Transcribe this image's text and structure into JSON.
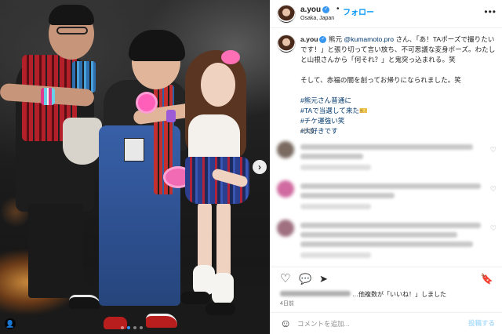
{
  "post": {
    "username": "a.you",
    "follow_label": "フォロー",
    "separator": "•",
    "location": "Osaka, Japan",
    "caption": {
      "author": "a.you",
      "line1_pre": "熊元 ",
      "mention": "@kumamoto.pro",
      "line1_post": " さん、「あ！TAポーズで撮りたいです！」と張り切って言い放ち、不可思議な変身ポーズ。わたしと山根さんから「何それ？」と鬼突っ込まれる。笑",
      "line2": "そして、赤福の闇を創ってお帰りになられました。笑",
      "hashtags": [
        "#熊元さん普通に",
        "#TAで当選して来た",
        "#チケ運強い笑",
        "#大好きです"
      ],
      "hashtag_emoji": "🎫",
      "time": "4日前"
    },
    "likes_suffix": "…他複数が「いいね！」しました",
    "time": "4日前",
    "comment_placeholder": "コメントを追加...",
    "post_label": "投稿する"
  },
  "icons": {
    "verified": "✓",
    "more": "•••",
    "next": "›",
    "user_tag": "👤",
    "like": "♡",
    "comment": "💬",
    "share": "➤",
    "save": "🔖",
    "emoji": "☺",
    "comment_like": "♡"
  },
  "colors": {
    "link": "#0095f6",
    "mention": "#00376b",
    "active_dot": "#3797f0"
  },
  "carousel": {
    "total": 4,
    "active_index": 1
  }
}
